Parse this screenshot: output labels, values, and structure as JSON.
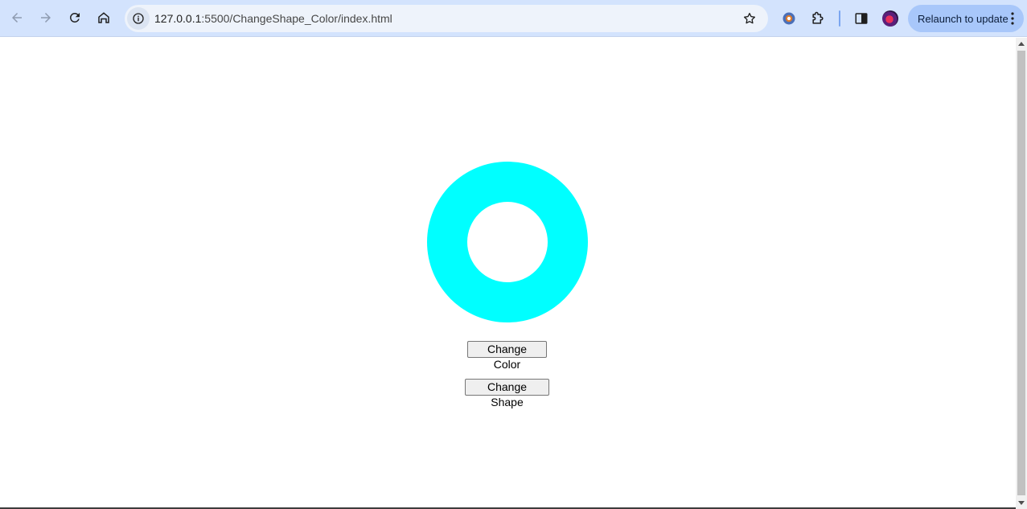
{
  "browser": {
    "url_host": "127.0.0.1",
    "url_path": ":5500/ChangeShape_Color/index.html",
    "relaunch_label": "Relaunch to update"
  },
  "page": {
    "shape_color": "#00ffff",
    "change_color_label": "Change Color",
    "change_shape_label": "Change Shape"
  }
}
